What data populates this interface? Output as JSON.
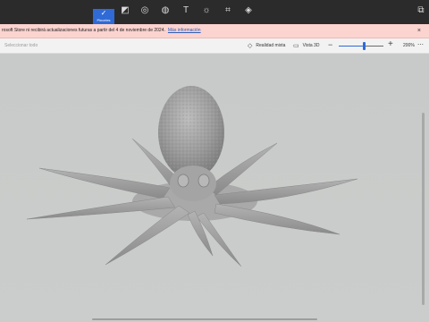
{
  "ribbon": {
    "active_tool": {
      "label": "Pinceles",
      "icon": "brush-icon"
    },
    "tools": [
      {
        "name": "2d-shapes-icon",
        "glyph": "◩"
      },
      {
        "name": "3d-shapes-icon",
        "glyph": "◎"
      },
      {
        "name": "stickers-icon",
        "glyph": "◍"
      },
      {
        "name": "text-icon",
        "glyph": "T"
      },
      {
        "name": "effects-icon",
        "glyph": "☼"
      },
      {
        "name": "canvas-icon",
        "glyph": "⌗"
      },
      {
        "name": "3d-library-icon",
        "glyph": "◈"
      }
    ],
    "paste_icon": "⧉"
  },
  "notice": {
    "message": "rosoft Store ni recibirá actualizaciones futuras a partir del 4 de noviembre de 2024.",
    "link": "Más información",
    "close": "×"
  },
  "toolbar": {
    "select_all": "Seleccionar todo",
    "mixed_reality": "Realidad mixta",
    "view_3d": "Vista 3D",
    "zoom_minus": "−",
    "zoom_plus": "+",
    "zoom_value": "200%",
    "zoom_level": 0.55,
    "more": "⋯"
  },
  "colors": {
    "accent": "#2f6ad6",
    "ribbon": "#2b2b2b",
    "notice": "#fbd3cf",
    "canvas": "#c9cbcb",
    "model": "#9e9e9e"
  }
}
